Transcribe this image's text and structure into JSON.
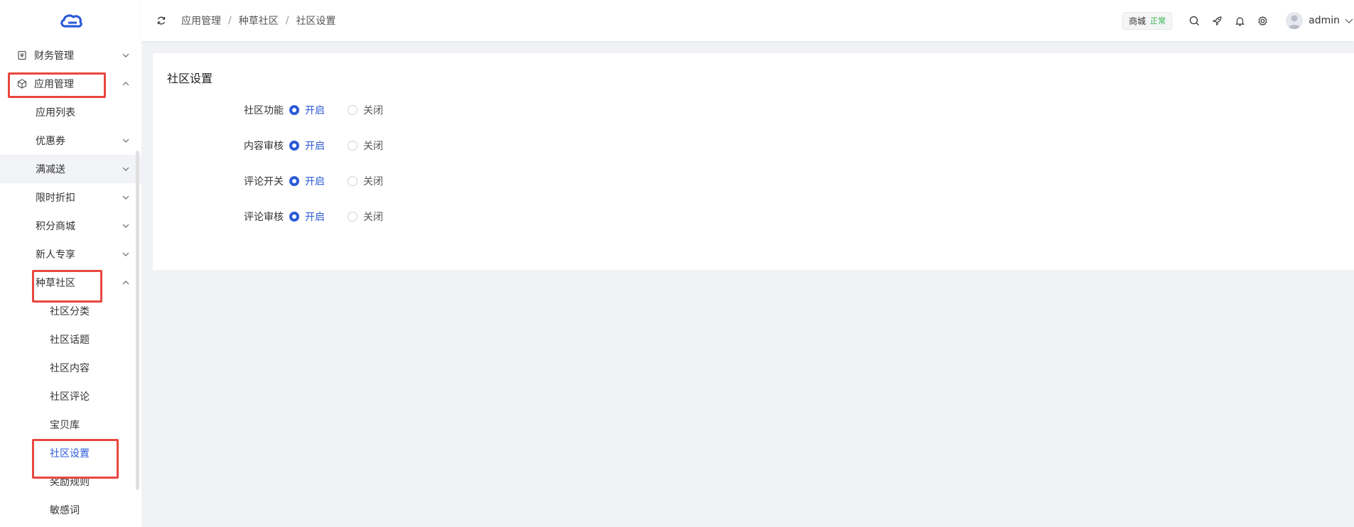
{
  "colors": {
    "accent": "#2d5bd8",
    "annotation": "#e8473f",
    "status_ok": "#2fb24a"
  },
  "sidebar": {
    "items": [
      {
        "label": "财务管理",
        "icon": "finance-icon"
      },
      {
        "label": "应用管理",
        "icon": "cube-icon"
      },
      {
        "label": "应用列表"
      },
      {
        "label": "优惠券"
      },
      {
        "label": "满减送"
      },
      {
        "label": "限时折扣"
      },
      {
        "label": "积分商城"
      },
      {
        "label": "新人专享"
      },
      {
        "label": "种草社区"
      },
      {
        "label": "社区分类"
      },
      {
        "label": "社区话题"
      },
      {
        "label": "社区内容"
      },
      {
        "label": "社区评论"
      },
      {
        "label": "宝贝库"
      },
      {
        "label": "社区设置"
      },
      {
        "label": "奖励规则"
      },
      {
        "label": "敏感词"
      }
    ]
  },
  "header": {
    "breadcrumb": [
      "应用管理",
      "种草社区",
      "社区设置"
    ],
    "breadcrumb_sep": "/",
    "shop_label": "商城",
    "shop_status": "正常",
    "username": "admin"
  },
  "main": {
    "title": "社区设置",
    "on_label": "开启",
    "off_label": "关闭",
    "settings": [
      {
        "label": "社区功能",
        "value": "开启"
      },
      {
        "label": "内容审核",
        "value": "开启"
      },
      {
        "label": "评论开关",
        "value": "开启"
      },
      {
        "label": "评论审核",
        "value": "开启"
      }
    ]
  }
}
